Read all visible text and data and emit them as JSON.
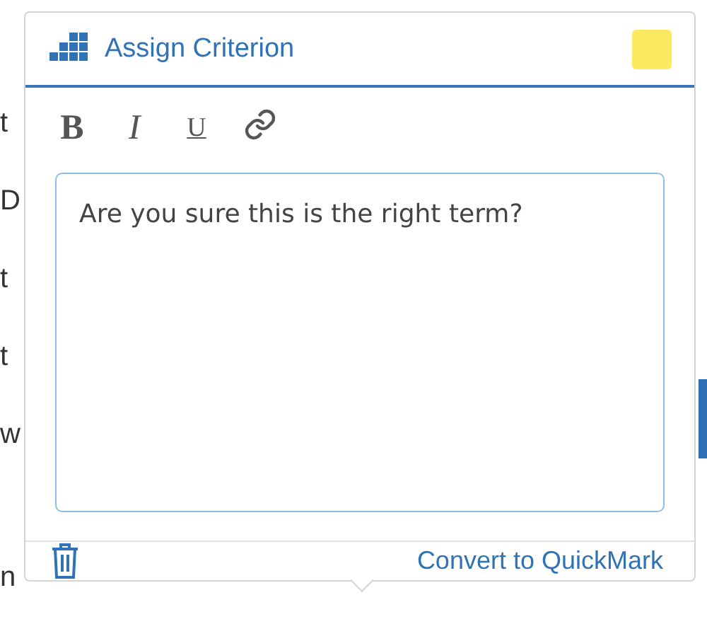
{
  "background_text": [
    {
      "left": "t"
    },
    {
      "left": "D"
    },
    {
      "left": "t"
    },
    {
      "left": "t"
    },
    {
      "left": "w"
    },
    {
      "left": "n"
    }
  ],
  "popup": {
    "title": "Assign Criterion",
    "color": "#fde95f",
    "toolbar": [
      {
        "kind": "bold",
        "label": "B"
      },
      {
        "kind": "italic",
        "label": "I"
      },
      {
        "kind": "underline",
        "label": "U"
      },
      {
        "kind": "link"
      }
    ],
    "comment": "Are you sure this is the right term?",
    "action": "Convert to QuickMark"
  }
}
